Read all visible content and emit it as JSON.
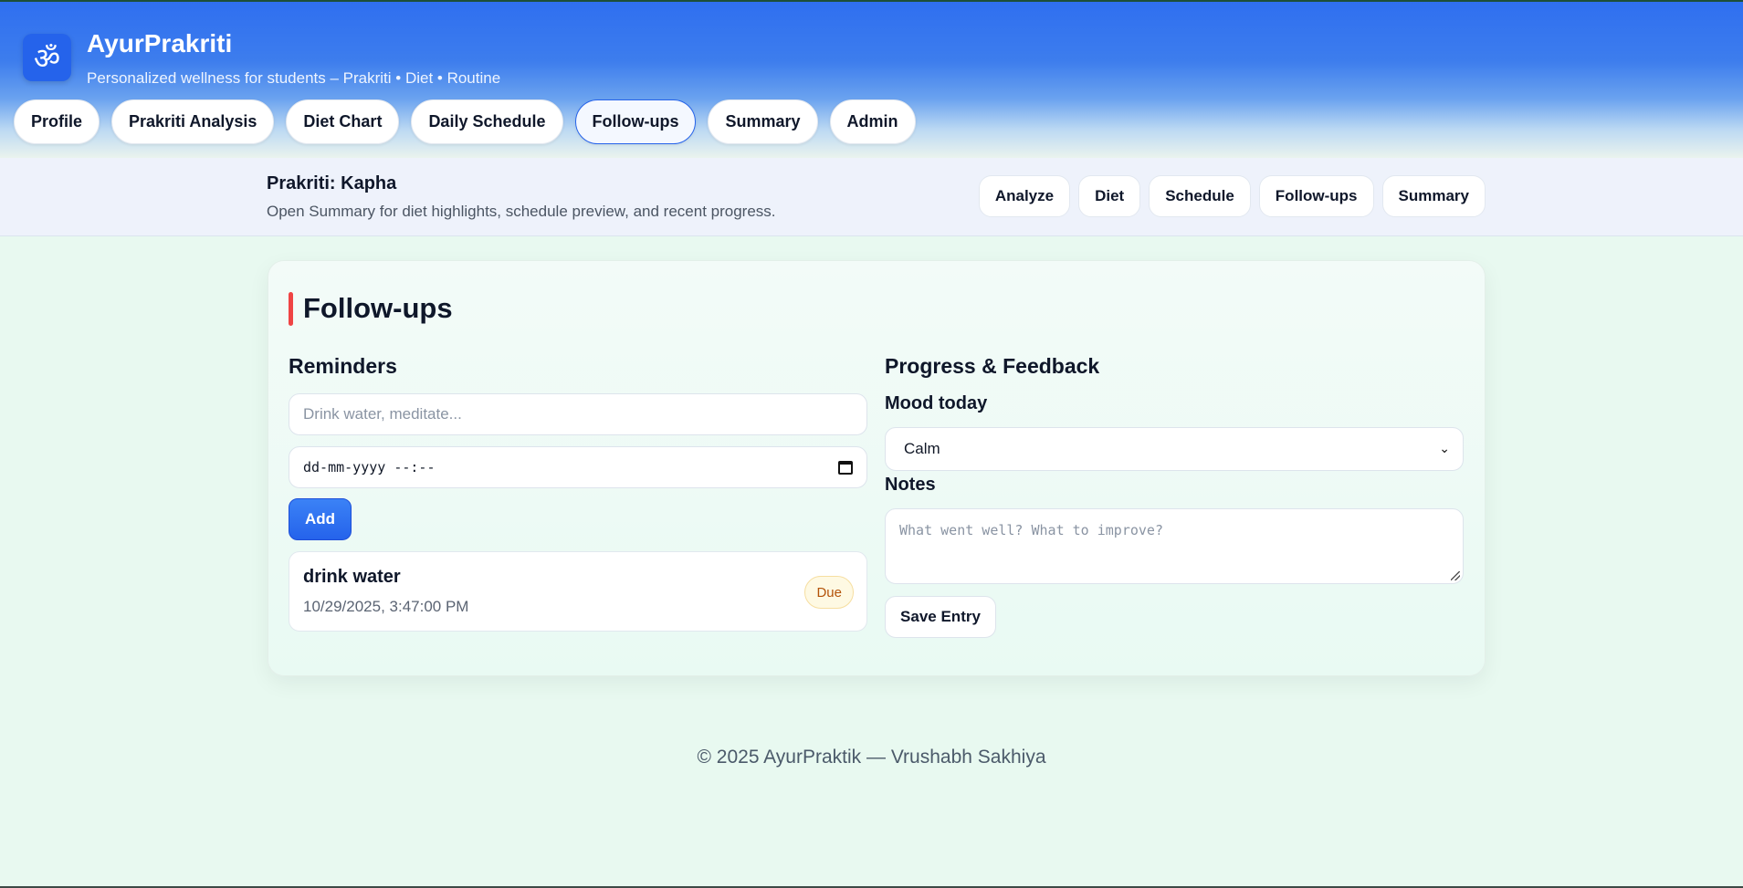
{
  "app": {
    "logo_glyph": "ॐ",
    "title": "AyurPrakriti",
    "subtitle": "Personalized wellness for students – Prakriti • Diet • Routine"
  },
  "nav": {
    "items": [
      {
        "label": "Profile"
      },
      {
        "label": "Prakriti Analysis"
      },
      {
        "label": "Diet Chart"
      },
      {
        "label": "Daily Schedule"
      },
      {
        "label": "Follow-ups",
        "active": true
      },
      {
        "label": "Summary"
      },
      {
        "label": "Admin"
      }
    ]
  },
  "subbar": {
    "title": "Prakriti: Kapha",
    "subtitle": "Open Summary for diet highlights, schedule preview, and recent progress.",
    "quick_links": [
      {
        "label": "Analyze"
      },
      {
        "label": "Diet"
      },
      {
        "label": "Schedule"
      },
      {
        "label": "Follow-ups"
      },
      {
        "label": "Summary"
      }
    ]
  },
  "followups": {
    "title": "Follow-ups",
    "reminders": {
      "heading": "Reminders",
      "input_placeholder": "Drink water, meditate...",
      "datetime_placeholder": "dd-mm-yyyy --:--",
      "add_label": "Add",
      "items": [
        {
          "title": "drink water",
          "time": "10/29/2025, 3:47:00 PM",
          "status": "Due"
        }
      ]
    },
    "progress": {
      "heading": "Progress & Feedback",
      "mood_label": "Mood today",
      "mood_value": "Calm",
      "notes_label": "Notes",
      "notes_placeholder": "What went well? What to improve?",
      "save_label": "Save Entry"
    }
  },
  "footer": {
    "text": "© 2025 AyurPraktik — Vrushabh Sakhiya"
  },
  "colors": {
    "primary": "#2563eb",
    "accent_bar": "#ef4444",
    "due_badge_text": "#b45309"
  }
}
